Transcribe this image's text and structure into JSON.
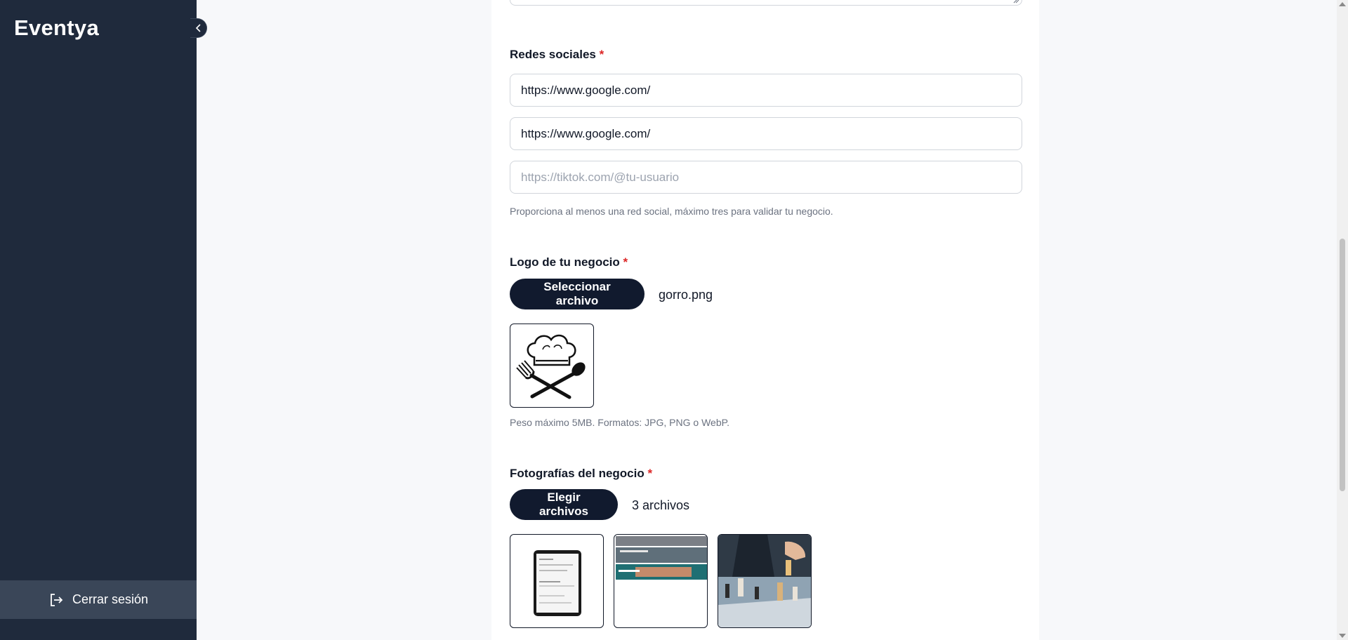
{
  "sidebar": {
    "brand": "Eventya",
    "collapse_icon": "chevron-left-icon",
    "logout_label": "Cerrar sesión",
    "logout_icon": "logout-icon"
  },
  "form": {
    "social": {
      "label": "Redes sociales",
      "required_mark": "*",
      "inputs": [
        {
          "value": "https://www.google.com/",
          "placeholder": ""
        },
        {
          "value": "https://www.google.com/",
          "placeholder": ""
        },
        {
          "value": "",
          "placeholder": "https://tiktok.com/@tu-usuario"
        }
      ],
      "help": "Proporciona al menos una red social, máximo tres para validar tu negocio."
    },
    "logo": {
      "label": "Logo de tu negocio",
      "required_mark": "*",
      "button_label": "Seleccionar archivo",
      "file_name": "gorro.png",
      "preview_icon": "chef-hat-utensils-icon",
      "help": "Peso máximo 5MB. Formatos: JPG, PNG o WebP."
    },
    "photos": {
      "label": "Fotografías del negocio",
      "required_mark": "*",
      "button_label": "Elegir archivos",
      "file_count": "3 archivos",
      "thumbnails": [
        "tablet-screenshot-thumbnail",
        "event-website-thumbnail",
        "chess-hand-photo-thumbnail"
      ]
    }
  },
  "colors": {
    "sidebar_bg": "#1f2a3c",
    "logout_bg": "#3a4658",
    "primary_button": "#111a2e",
    "required": "#dc2626"
  }
}
